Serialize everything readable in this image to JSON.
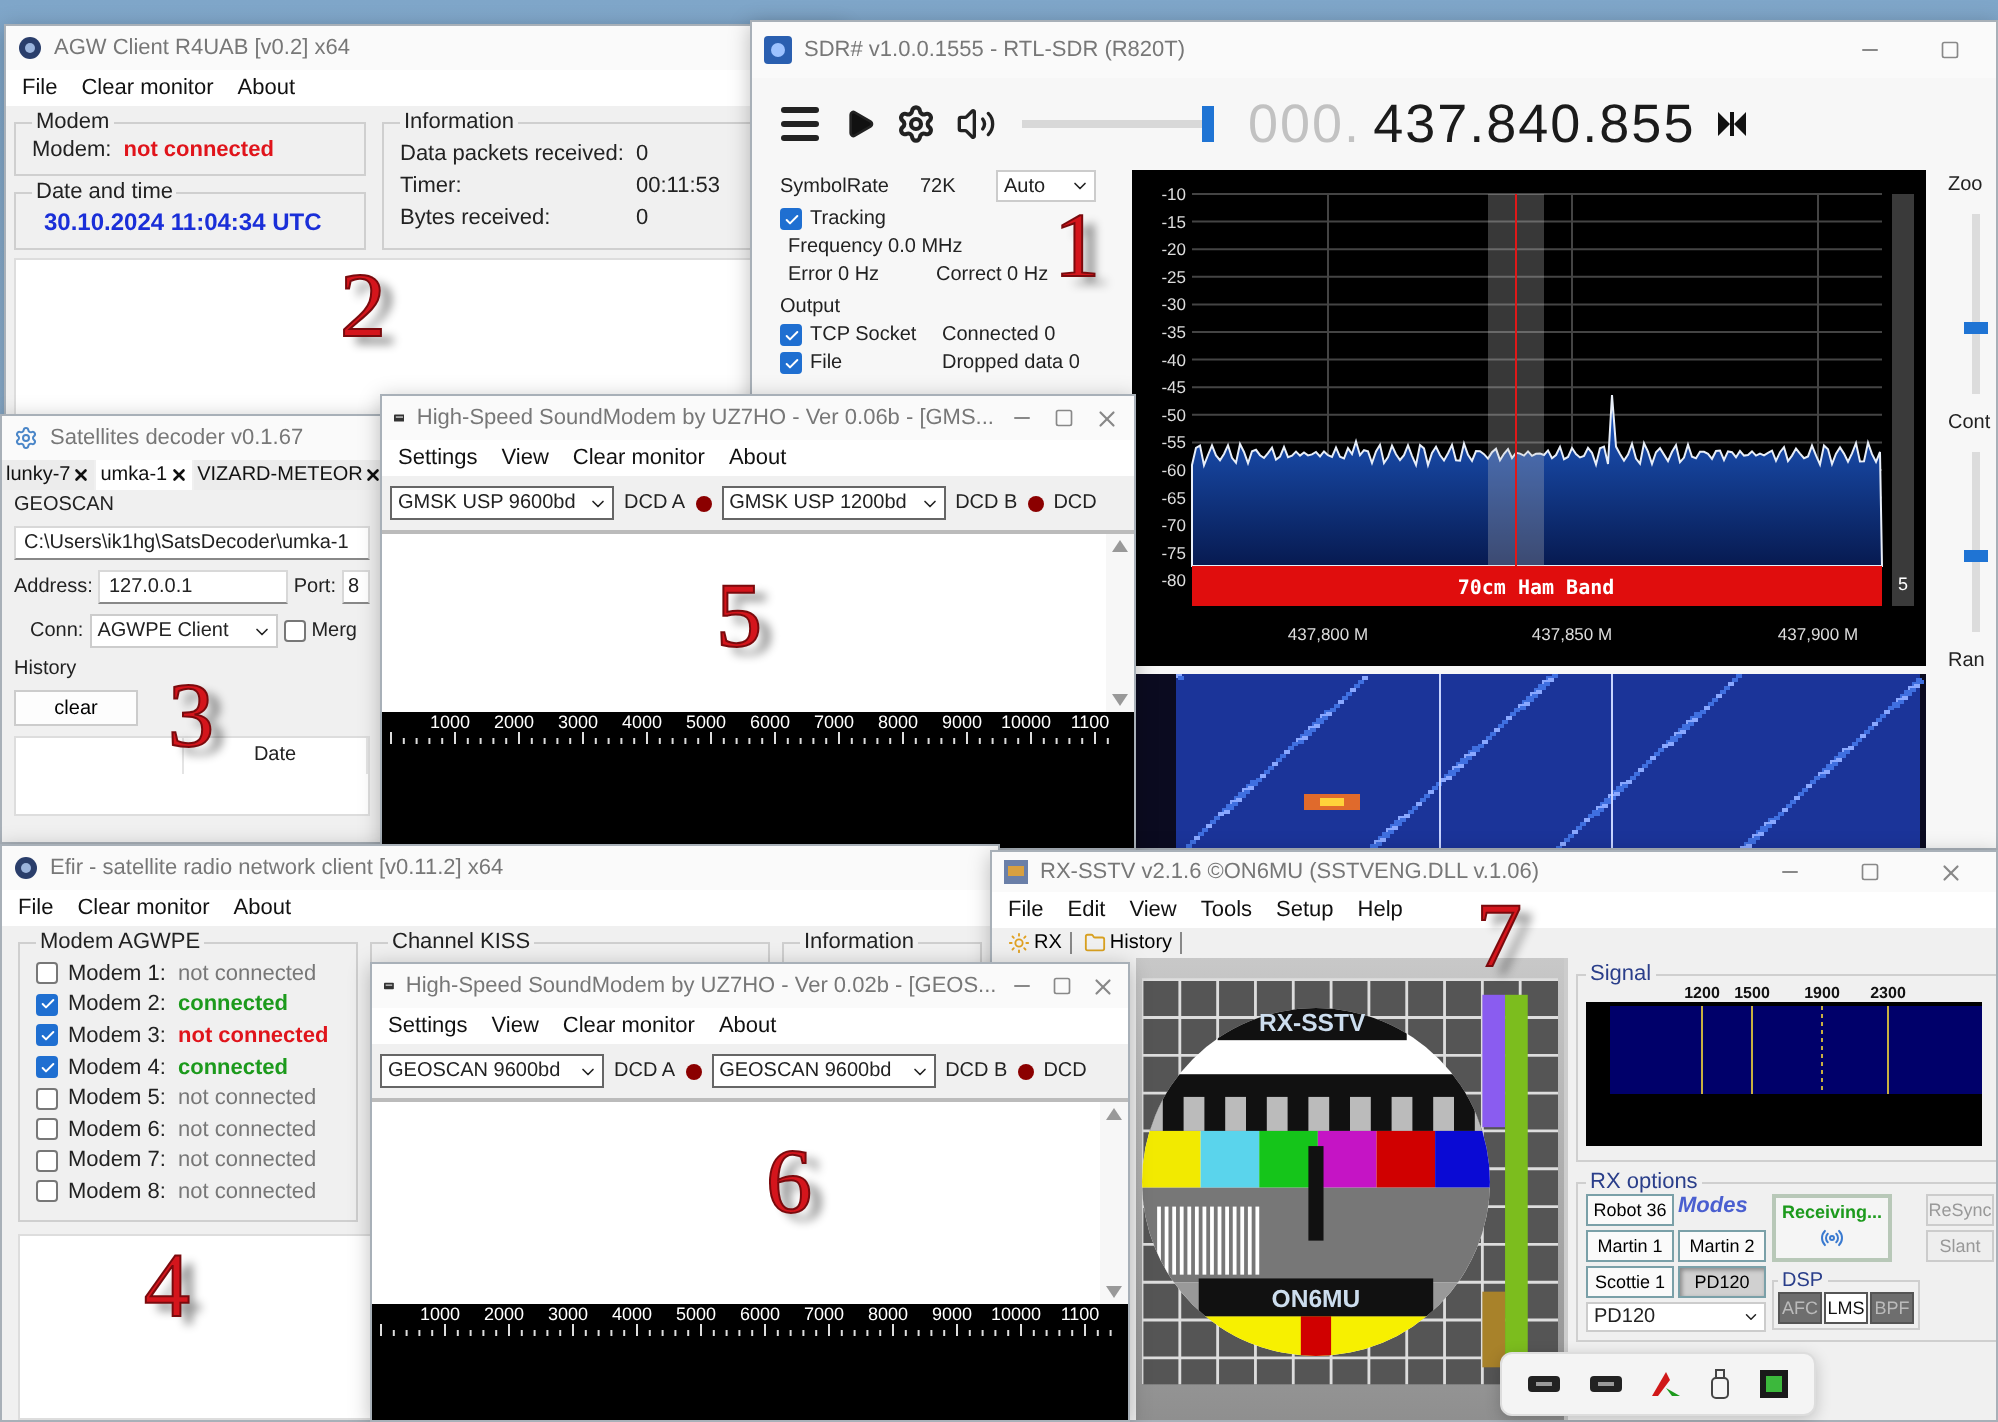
{
  "annotations": [
    "1",
    "2",
    "3",
    "4",
    "5",
    "6",
    "7"
  ],
  "agw_client": {
    "title": "AGW Client R4UAB [v0.2] x64",
    "menu": [
      "File",
      "Clear monitor",
      "About"
    ],
    "modem": {
      "title": "Modem",
      "label": "Modem:",
      "status": "not connected",
      "connected": false
    },
    "datetime": {
      "title": "Date and time",
      "value": "30.10.2024 11:04:34 UTC"
    },
    "information": {
      "title": "Information",
      "rows": [
        {
          "label": "Data packets received:",
          "value": "0"
        },
        {
          "label": "Timer:",
          "value": "00:11:53"
        },
        {
          "label": "Bytes received:",
          "value": "0"
        }
      ]
    }
  },
  "sdr": {
    "title": "SDR# v1.0.0.1555 - RTL-SDR (R820T)",
    "volume": {
      "level": 0.95
    },
    "frequency_prefix": "000.",
    "frequency": "437.840.855",
    "symbol_rate": {
      "label": "SymbolRate",
      "value": "72K",
      "mode": "Auto"
    },
    "tracking": {
      "label": "Tracking",
      "checked": true,
      "frequency": "Frequency 0.0 MHz",
      "error": "Error 0 Hz",
      "correct": "Correct 0 Hz"
    },
    "output": {
      "title": "Output",
      "rows": [
        {
          "label": "TCP Socket",
          "checked": true,
          "status": "Connected 0"
        },
        {
          "label": "File",
          "checked": true,
          "status": "Dropped data 0"
        }
      ]
    },
    "spectrum": {
      "yticks": [
        "-10",
        "-15",
        "-20",
        "-25",
        "-30",
        "-35",
        "-40",
        "-45",
        "-50",
        "-55",
        "-60",
        "-65",
        "-70",
        "-75",
        "-80"
      ],
      "xticks": [
        "437,800 M",
        "437,850 M",
        "437,900 M"
      ],
      "band": "70cm Ham Band",
      "scale_value": "5"
    },
    "side_sliders": [
      {
        "label": "Zoo",
        "level": 0.37
      },
      {
        "label": "Cont",
        "level": 0.42
      },
      {
        "label": "Ran"
      }
    ]
  },
  "satellites_decoder": {
    "title": "Satellites decoder v0.1.67",
    "tabs": [
      {
        "label": "lunky-7",
        "selected": false
      },
      {
        "label": "umka-1",
        "selected": true
      },
      {
        "label": "VIZARD-METEOR",
        "selected": false
      }
    ],
    "satellite": "GEOSCAN",
    "path": "C:\\Users\\ik1hg\\SatsDecoder\\umka-1",
    "address_label": "Address:",
    "address": "127.0.0.1",
    "port_label": "Port:",
    "port": "8",
    "conn_label": "Conn:",
    "conn": "AGWPE Client",
    "merge": {
      "label": "Merg",
      "checked": false
    },
    "history": {
      "title": "History",
      "clear": "clear",
      "columns": [
        "Date"
      ]
    }
  },
  "soundmodem_1": {
    "title": "High-Speed SoundModem by UZ7HO - Ver 0.06b - [GMS...",
    "menu": [
      "Settings",
      "View",
      "Clear monitor",
      "About"
    ],
    "channels": [
      {
        "mode": "GMSK USP 9600bd",
        "dcd": "DCD A"
      },
      {
        "mode": "GMSK USP 1200bd",
        "dcd": "DCD B"
      }
    ],
    "dcd_extra": "DCD",
    "scale": [
      "1000",
      "2000",
      "3000",
      "4000",
      "5000",
      "6000",
      "7000",
      "8000",
      "9000",
      "10000",
      "1100"
    ]
  },
  "efir": {
    "title": "Efir - satellite radio network client [v0.11.2] x64",
    "menu": [
      "File",
      "Clear monitor",
      "About"
    ],
    "modem_group": {
      "title": "Modem AGWPE",
      "modems": [
        {
          "label": "Modem 1:",
          "checked": false,
          "connected": false,
          "status": "not connected"
        },
        {
          "label": "Modem 2:",
          "checked": true,
          "connected": true,
          "status": "connected"
        },
        {
          "label": "Modem 3:",
          "checked": true,
          "connected": false,
          "status": "not connected"
        },
        {
          "label": "Modem 4:",
          "checked": true,
          "connected": true,
          "status": "connected"
        },
        {
          "label": "Modem 5:",
          "checked": false,
          "connected": false,
          "status": "not connected"
        },
        {
          "label": "Modem 6:",
          "checked": false,
          "connected": false,
          "status": "not connected"
        },
        {
          "label": "Modem 7:",
          "checked": false,
          "connected": false,
          "status": "not connected"
        },
        {
          "label": "Modem 8:",
          "checked": false,
          "connected": false,
          "status": "not connected"
        }
      ]
    },
    "channel_group": {
      "title": "Channel KISS"
    },
    "information_group": {
      "title": "Information"
    }
  },
  "soundmodem_2": {
    "title": "High-Speed SoundModem by UZ7HO - Ver 0.02b - [GEOS...",
    "menu": [
      "Settings",
      "View",
      "Clear monitor",
      "About"
    ],
    "channels": [
      {
        "mode": "GEOSCAN 9600bd",
        "dcd": "DCD A"
      },
      {
        "mode": "GEOSCAN 9600bd",
        "dcd": "DCD B"
      }
    ],
    "dcd_extra": "DCD",
    "scale": [
      "1000",
      "2000",
      "3000",
      "4000",
      "5000",
      "6000",
      "7000",
      "8000",
      "9000",
      "10000",
      "1100"
    ]
  },
  "rx_sstv": {
    "title": "RX-SSTV v2.1.6 ©ON6MU (SSTVENG.DLL v.1.06)",
    "menu": [
      "File",
      "Edit",
      "View",
      "Tools",
      "Setup",
      "Help"
    ],
    "toolbar": [
      "RX",
      "History"
    ],
    "test_card": {
      "title": "RX-SSTV",
      "caption": "ON6MU"
    },
    "signal": {
      "title": "Signal",
      "ticks": [
        "1200",
        "1500",
        "1900",
        "2300"
      ]
    },
    "rx_options": {
      "title": "RX options",
      "modes": [
        {
          "label": "Robot 36",
          "selected": false
        },
        {
          "label": "Martin 1",
          "selected": false
        },
        {
          "label": "Martin 2",
          "selected": false
        },
        {
          "label": "Scottie 1",
          "selected": false
        },
        {
          "label": "PD120",
          "selected": true
        }
      ],
      "modes_logo": "Modes",
      "mode_select": "PD120",
      "status": "Receiving...",
      "resync": "ReSync",
      "slant": "Slant"
    },
    "dsp": {
      "title": "DSP",
      "toggles": [
        {
          "label": "AFC",
          "on": true
        },
        {
          "label": "LMS",
          "on": false
        },
        {
          "label": "BPF",
          "on": true
        }
      ]
    }
  }
}
